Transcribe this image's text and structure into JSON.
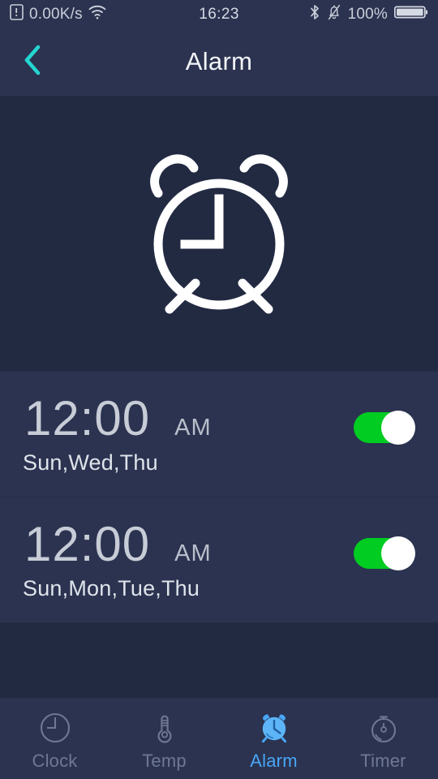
{
  "statusbar": {
    "data_icon": "sim-card-icon",
    "network_speed": "0.00K/s",
    "wifi_icon": "wifi-icon",
    "clock": "16:23",
    "bluetooth_icon": "bluetooth-icon",
    "silent_icon": "bell-muted-icon",
    "battery_percent": "100%",
    "battery_icon": "battery-full-icon"
  },
  "header": {
    "back_icon": "chevron-left-icon",
    "title": "Alarm",
    "back_color": "#24d6d0"
  },
  "hero": {
    "icon": "alarm-clock-illustration",
    "stroke_color": "#ffffff"
  },
  "alarms": [
    {
      "time": "12:00",
      "meridiem": "AM",
      "days": "Sun,Wed,Thu",
      "enabled": "on"
    },
    {
      "time": "12:00",
      "meridiem": "AM",
      "days": "Sun,Mon,Tue,Thu",
      "enabled": "on"
    }
  ],
  "tabs": [
    {
      "label": "Clock",
      "icon": "clock-icon",
      "active": "false"
    },
    {
      "label": "Temp",
      "icon": "thermometer-icon",
      "active": "false"
    },
    {
      "label": "Alarm",
      "icon": "alarm-clock-icon",
      "active": "true"
    },
    {
      "label": "Timer",
      "icon": "stopwatch-icon",
      "active": "false"
    }
  ],
  "colors": {
    "background": "#222a42",
    "panel": "#2b3350",
    "accent_cyan": "#24d6d0",
    "accent_blue": "#49a6f5",
    "toggle_on": "#00cc22",
    "text_primary": "#f2f4f8",
    "text_muted": "#6f7893"
  }
}
